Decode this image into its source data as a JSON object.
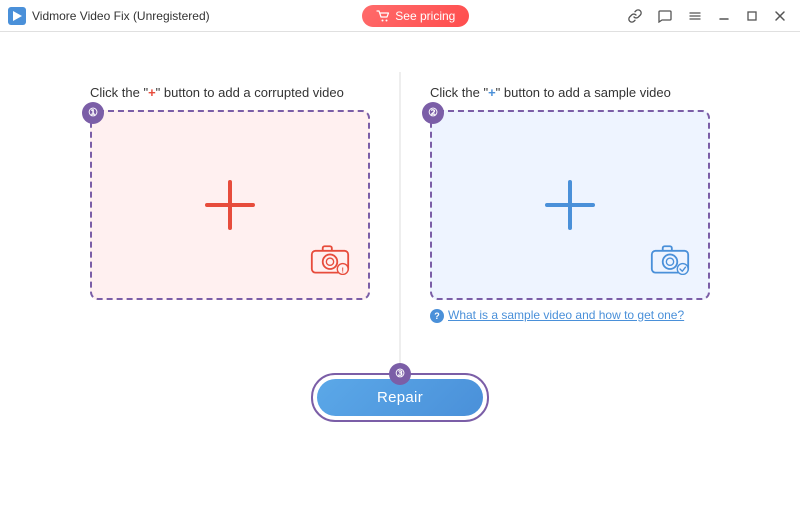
{
  "titleBar": {
    "appName": "Vidmore Video Fix (Unregistered)",
    "seePricingLabel": "See pricing",
    "icons": {
      "link": "🔗",
      "chat": "💬",
      "menu": "☰",
      "minimize": "—",
      "maximize": "□",
      "close": "✕"
    }
  },
  "leftPanel": {
    "instructionPrefix": "Click the \"",
    "instructionPlus": "+",
    "instructionSuffix": "\" button to add a corrupted video",
    "badge": "①"
  },
  "rightPanel": {
    "instructionPrefix": "Click the \"",
    "instructionPlus": "+",
    "instructionSuffix": "\" button to add a sample video",
    "badge": "②",
    "helpText": "What is a sample video and how to get one?"
  },
  "repairSection": {
    "badge": "③",
    "buttonLabel": "Repair"
  }
}
